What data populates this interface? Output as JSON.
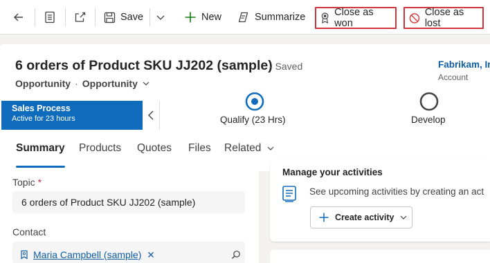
{
  "toolbar": {
    "save_label": "Save",
    "new_label": "New",
    "summarize_label": "Summarize",
    "close_won_label": "Close as won",
    "close_lost_label": "Close as lost"
  },
  "header": {
    "title": "6 orders of Product SKU JJ202 (sample)",
    "saved_status": "- Saved",
    "entity_type": "Opportunity",
    "separator": "·",
    "form_name": "Opportunity",
    "account_name": "Fabrikam, In",
    "account_label": "Account"
  },
  "process": {
    "name": "Sales Process",
    "active_for": "Active for 23 hours",
    "stages": [
      {
        "label": "Qualify",
        "duration": "(23 Hrs)",
        "status": "active"
      },
      {
        "label": "Develop",
        "duration": "",
        "status": "pending"
      }
    ]
  },
  "tabs": [
    "Summary",
    "Products",
    "Quotes",
    "Files",
    "Related"
  ],
  "form": {
    "topic_label": "Topic",
    "topic_required": "*",
    "topic_value": "6 orders of Product SKU JJ202 (sample)",
    "contact_label": "Contact",
    "contact_value": "Maria Campbell (sample)"
  },
  "activities": {
    "heading": "Manage your activities",
    "description": "See upcoming activities by creating an act",
    "create_label": "Create activity"
  },
  "colors": {
    "accent": "#0f6cbd",
    "highlight_border": "#d13438",
    "required": "#c4314b",
    "link": "#115ea3",
    "new_icon": "#107c10"
  },
  "icons": {
    "back": "back-arrow-icon",
    "form": "form-icon",
    "popout": "open-in-new-window-icon",
    "save": "save-icon",
    "more": "chevron-down-icon",
    "new": "plus-icon",
    "summarize": "summarize-icon",
    "won": "ribbon-icon",
    "lost": "prohibited-icon",
    "collapse": "chevron-left-icon",
    "contact": "contact-card-icon",
    "remove": "close-icon",
    "search": "search-icon",
    "activity": "activity-list-icon"
  }
}
